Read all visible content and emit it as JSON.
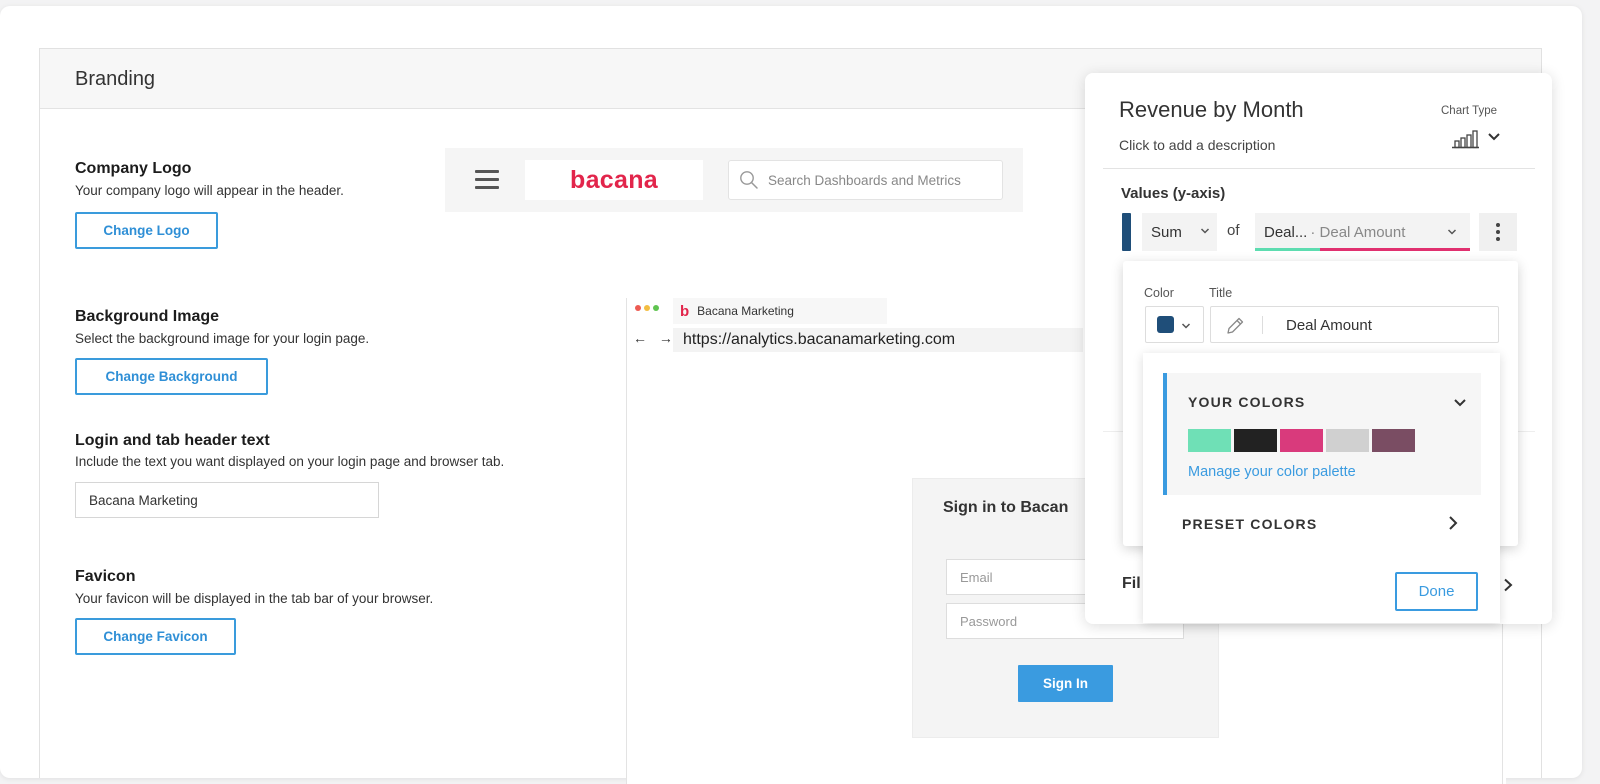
{
  "panel": {
    "title": "Branding"
  },
  "company_logo": {
    "title": "Company Logo",
    "description": "Your company logo will appear in the header.",
    "button": "Change Logo"
  },
  "background_image": {
    "title": "Background Image",
    "description": "Select the background image for your login page.",
    "button": "Change Background"
  },
  "header_text": {
    "title": "Login and tab header text",
    "description": "Include the text you want displayed on your login page and browser tab.",
    "value": "Bacana Marketing"
  },
  "favicon": {
    "title": "Favicon",
    "description": "Your favicon will be displayed in the tab bar of your browser.",
    "button": "Change Favicon"
  },
  "header_preview": {
    "logo_text": "bacana",
    "search_placeholder": "Search Dashboards and Metrics",
    "icons": [
      "hamburger-icon",
      "search-icon"
    ]
  },
  "browser_preview": {
    "tab_icon": "b",
    "tab_label": "Bacana Marketing",
    "nav_arrows": "← →",
    "url": "https://analytics.bacanamarketing.com",
    "dot_colors": [
      "#ed5b52",
      "#f3bd42",
      "#5fc450"
    ]
  },
  "signin": {
    "title": "Sign in to Bacan",
    "email_placeholder": "Email",
    "password_placeholder": "Password",
    "button": "Sign In"
  },
  "chart_config": {
    "title": "Revenue by Month",
    "description": "Click to add a description",
    "chart_type_label": "Chart Type",
    "values_label": "Values (y-axis)",
    "aggregation": "Sum",
    "of_label": "of",
    "field_short": "Deal...",
    "field_full": "· Deal Amount",
    "filters_label": "Fil",
    "series_color": "#1f4e79"
  },
  "series_settings": {
    "color_label": "Color",
    "title_label": "Title",
    "title_value": "Deal Amount"
  },
  "palette": {
    "your_colors_label": "YOUR COLORS",
    "swatches": [
      "#6fe0b6",
      "#222222",
      "#d93a7c",
      "#d0d0d0",
      "#7a4d63"
    ],
    "manage_link": "Manage your color palette",
    "preset_label": "PRESET COLORS",
    "done_button": "Done"
  },
  "colors": {
    "accent": "#3a9be0",
    "brand": "#e2254b"
  }
}
